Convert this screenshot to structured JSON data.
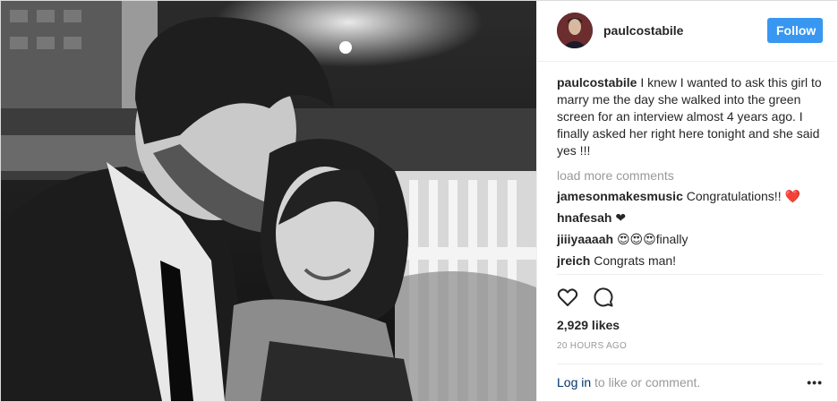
{
  "header": {
    "username": "paulcostabile",
    "follow_label": "Follow"
  },
  "caption": {
    "username": "paulcostabile",
    "text": "I knew I wanted to ask this girl to marry me the day she walked into the green screen for an interview almost 4 years ago. I finally asked her right here tonight and she said yes !!!"
  },
  "load_more": "load more comments",
  "comments": [
    {
      "username": "jamesonmakesmusic",
      "text": "Congratulations!! ❤️"
    },
    {
      "username": "hnafesah",
      "text": "❤"
    },
    {
      "username": "jiiiyaaaah",
      "text": "😍😍😍finally"
    },
    {
      "username": "jreich",
      "text": "Congrats man!"
    }
  ],
  "actions": {
    "like_icon": "heart-outline-icon",
    "comment_icon": "speech-bubble-icon"
  },
  "likes": "2,929 likes",
  "timestamp": "20 HOURS AGO",
  "login_bar": {
    "login_label": "Log in",
    "rest_text": " to like or comment.",
    "more_label": "•••"
  },
  "colors": {
    "follow_button": "#3897f0",
    "border": "#dbdbdb",
    "muted_text": "#999999",
    "link": "#003569"
  }
}
